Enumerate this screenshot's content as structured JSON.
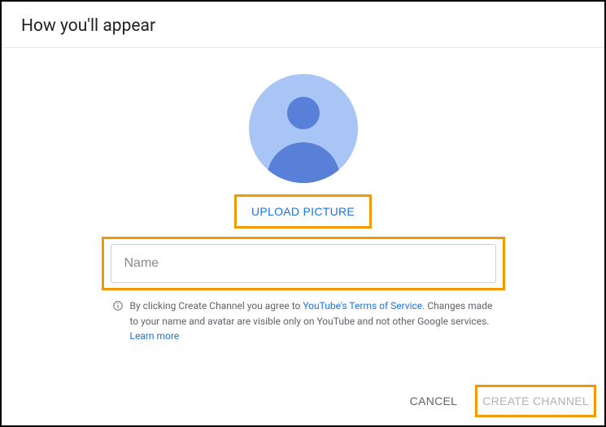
{
  "header": {
    "title": "How you'll appear"
  },
  "avatar": {
    "icon_name": "default-avatar"
  },
  "upload": {
    "label": "UPLOAD PICTURE"
  },
  "name_field": {
    "placeholder": "Name",
    "value": ""
  },
  "disclaimer": {
    "prefix": "By clicking Create Channel you agree to ",
    "tos_link_text": "YouTube's Terms of Service",
    "middle": ". Changes made to your name and avatar are visible only on YouTube and not other Google services. ",
    "learn_more_text": "Learn more"
  },
  "footer": {
    "cancel_label": "CANCEL",
    "create_label": "CREATE CHANNEL"
  },
  "colors": {
    "highlight": "#f29900",
    "link": "#1a73e8",
    "avatar_bg": "#a9c5f5",
    "avatar_fg": "#5880d8"
  }
}
